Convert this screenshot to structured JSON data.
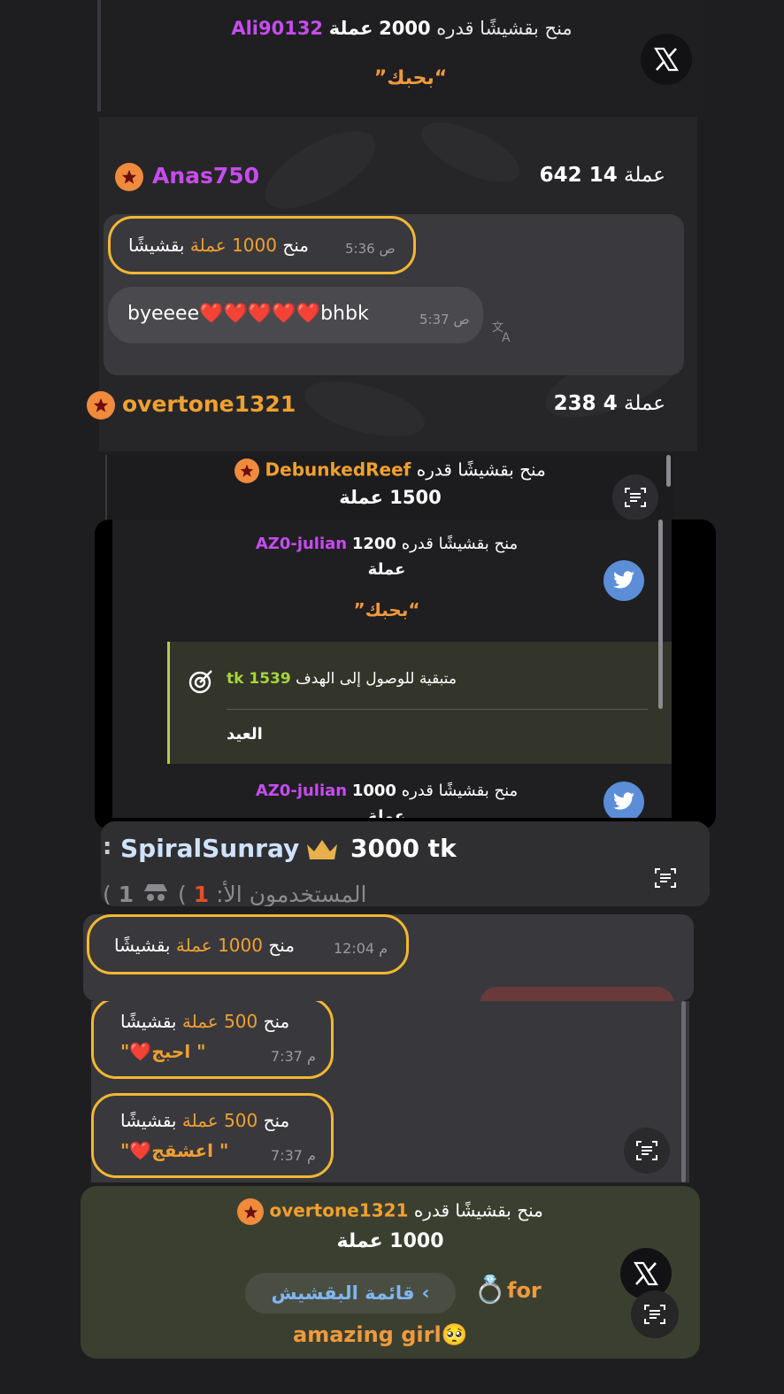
{
  "gift_banner_1": {
    "text_prefix": "منح بقشيشًا قدره",
    "amount": "2000",
    "unit": "عملة",
    "username": "Ali90132",
    "message": "“بحبك”"
  },
  "user_row_1": {
    "username": "Anas750",
    "coins_label": "عملة",
    "coins": "14 642"
  },
  "chat_1": {
    "tip_msg": {
      "time": "5:36",
      "ampm": "ص",
      "prefix": "منح",
      "amount": "1000",
      "unit": "عملة",
      "suffix": "بقشيشًا"
    },
    "text_msg": {
      "text": "byeeee❤️❤️❤️❤️❤️bhbk",
      "time": "5:37",
      "ampm": "ص"
    }
  },
  "user_row_2": {
    "username": "overtone1321",
    "coins_label": "عملة",
    "coins": "4 238"
  },
  "gift_banner_2": {
    "text_prefix": "منح بقشيشًا قدره",
    "username": "DebunkedReef",
    "amount_line": "1500 عملة"
  },
  "twitter_feed": {
    "item1": {
      "prefix": "منح بقشيشًا قدره",
      "amount": "1200",
      "username": "AZ0-julian",
      "unit": "عملة",
      "message": "“بحبك”"
    },
    "goal": {
      "label": "متبقية للوصول إلى الهدف",
      "value": "1539 tk",
      "title": "العيد"
    },
    "item2": {
      "prefix": "منح بقشيشًا قدره",
      "amount": "1000",
      "username": "AZ0-julian",
      "unit": "عملة"
    }
  },
  "top_tipper": {
    "colon": ":",
    "username": "SpiralSunray",
    "amount": "3000 tk",
    "users_line_label": ":المستخدمون الأ",
    "users_count": "1",
    "anon_count": "1"
  },
  "chat_2": {
    "tip_msg": {
      "time": "12:04",
      "ampm": "م",
      "prefix": "منح",
      "amount": "1000",
      "unit": "عملة",
      "suffix": "بقشيشًا"
    }
  },
  "chat_3": {
    "msg1": {
      "prefix": "منح",
      "amount": "500",
      "unit": "عملة",
      "suffix": "بقشيشًا",
      "note": "\"❤️احبج \"",
      "time": "7:37",
      "ampm": "م"
    },
    "msg2": {
      "prefix": "منح",
      "amount": "500",
      "unit": "عملة",
      "suffix": "بقشيشًا",
      "note": "\"❤️اعشقج \"",
      "time": "7:37",
      "ampm": "م"
    }
  },
  "gift_banner_3": {
    "text_prefix": "منح بقشيشًا قدره",
    "username": "overtone1321",
    "amount_line": "1000 عملة",
    "list_button": "قائمة البقشيش",
    "for_text": "for",
    "message": "amazing girl🥺"
  },
  "colors": {
    "accent_orange": "#f0a030",
    "accent_purple": "#c64cf0",
    "highlight_yellow": "#f3b733",
    "twitter_blue": "#5b8ed6"
  }
}
